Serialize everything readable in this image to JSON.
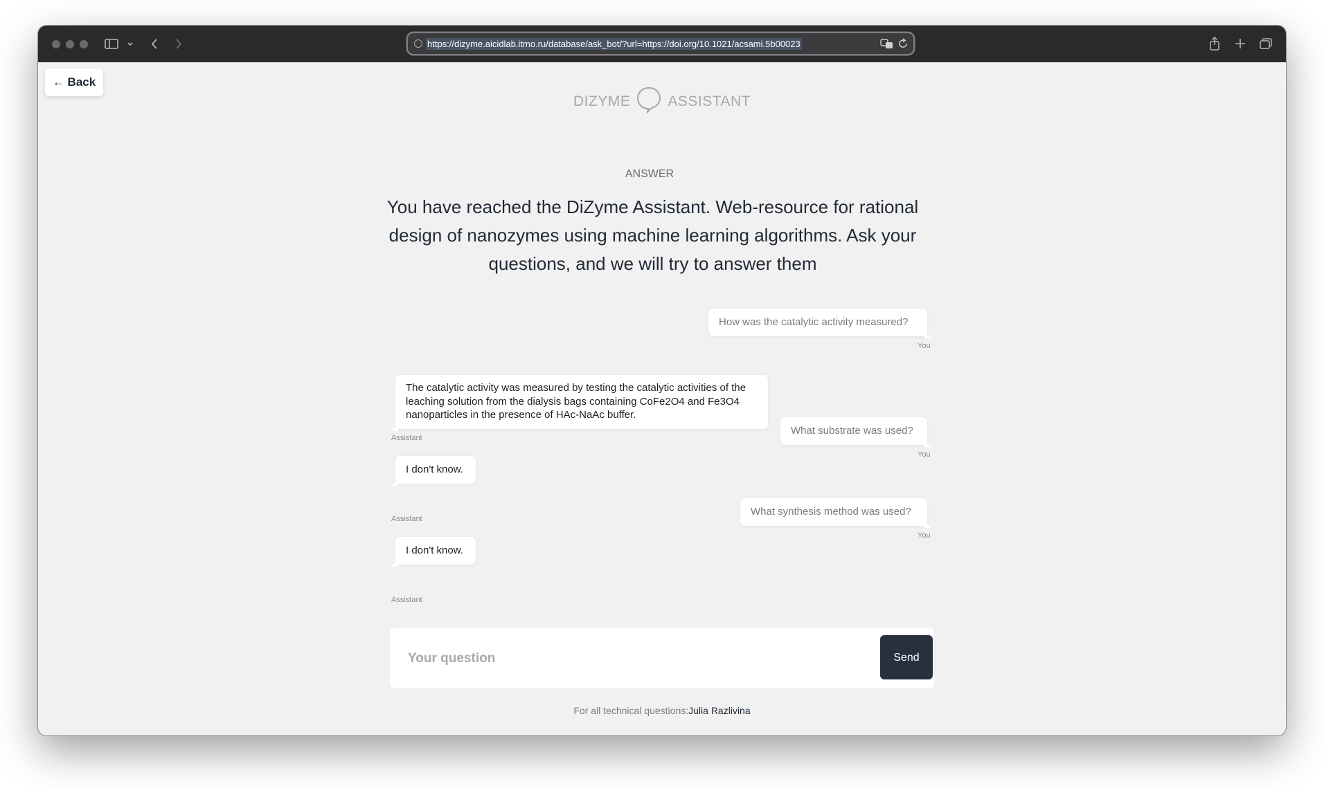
{
  "browser": {
    "url": "https://dizyme.aicidlab.itmo.ru/database/ask_bot/?url=https://doi.org/10.1021/acsami.5b00023"
  },
  "page": {
    "back_label": "← Back",
    "brand_left": "DIZYME",
    "brand_right": "ASSISTANT",
    "answer_label": "ANSWER",
    "headline": "You have reached the DiZyme Assistant. Web-resource for rational design of nanozymes using machine learning algorithms. Ask your questions, and we will try to answer them"
  },
  "chat": {
    "messages": [
      {
        "role": "user",
        "text": "How was the catalytic activity measured?",
        "sender": "You"
      },
      {
        "role": "assistant",
        "text": "The catalytic activity was measured by testing the catalytic activities of the leaching solution from the dialysis bags containing CoFe2O4 and Fe3O4 nanoparticles in the presence of HAc-NaAc buffer.",
        "sender": "Assistant"
      },
      {
        "role": "user",
        "text": "What substrate was used?",
        "sender": "You"
      },
      {
        "role": "assistant",
        "text": "I don't know.",
        "sender": "Assistant"
      },
      {
        "role": "user",
        "text": "What synthesis method was used?",
        "sender": "You"
      },
      {
        "role": "assistant",
        "text": "I don't know.",
        "sender": "Assistant"
      }
    ]
  },
  "input": {
    "placeholder": "Your question",
    "value": "",
    "send_label": "Send"
  },
  "footer": {
    "prefix": "For all technical questions:",
    "contact_name": "Julia Razlivina"
  },
  "icons": {
    "sidebar": "sidebar-toggle-icon",
    "share": "share-icon",
    "new_tab": "plus-icon",
    "tabs": "tab-overview-icon"
  }
}
